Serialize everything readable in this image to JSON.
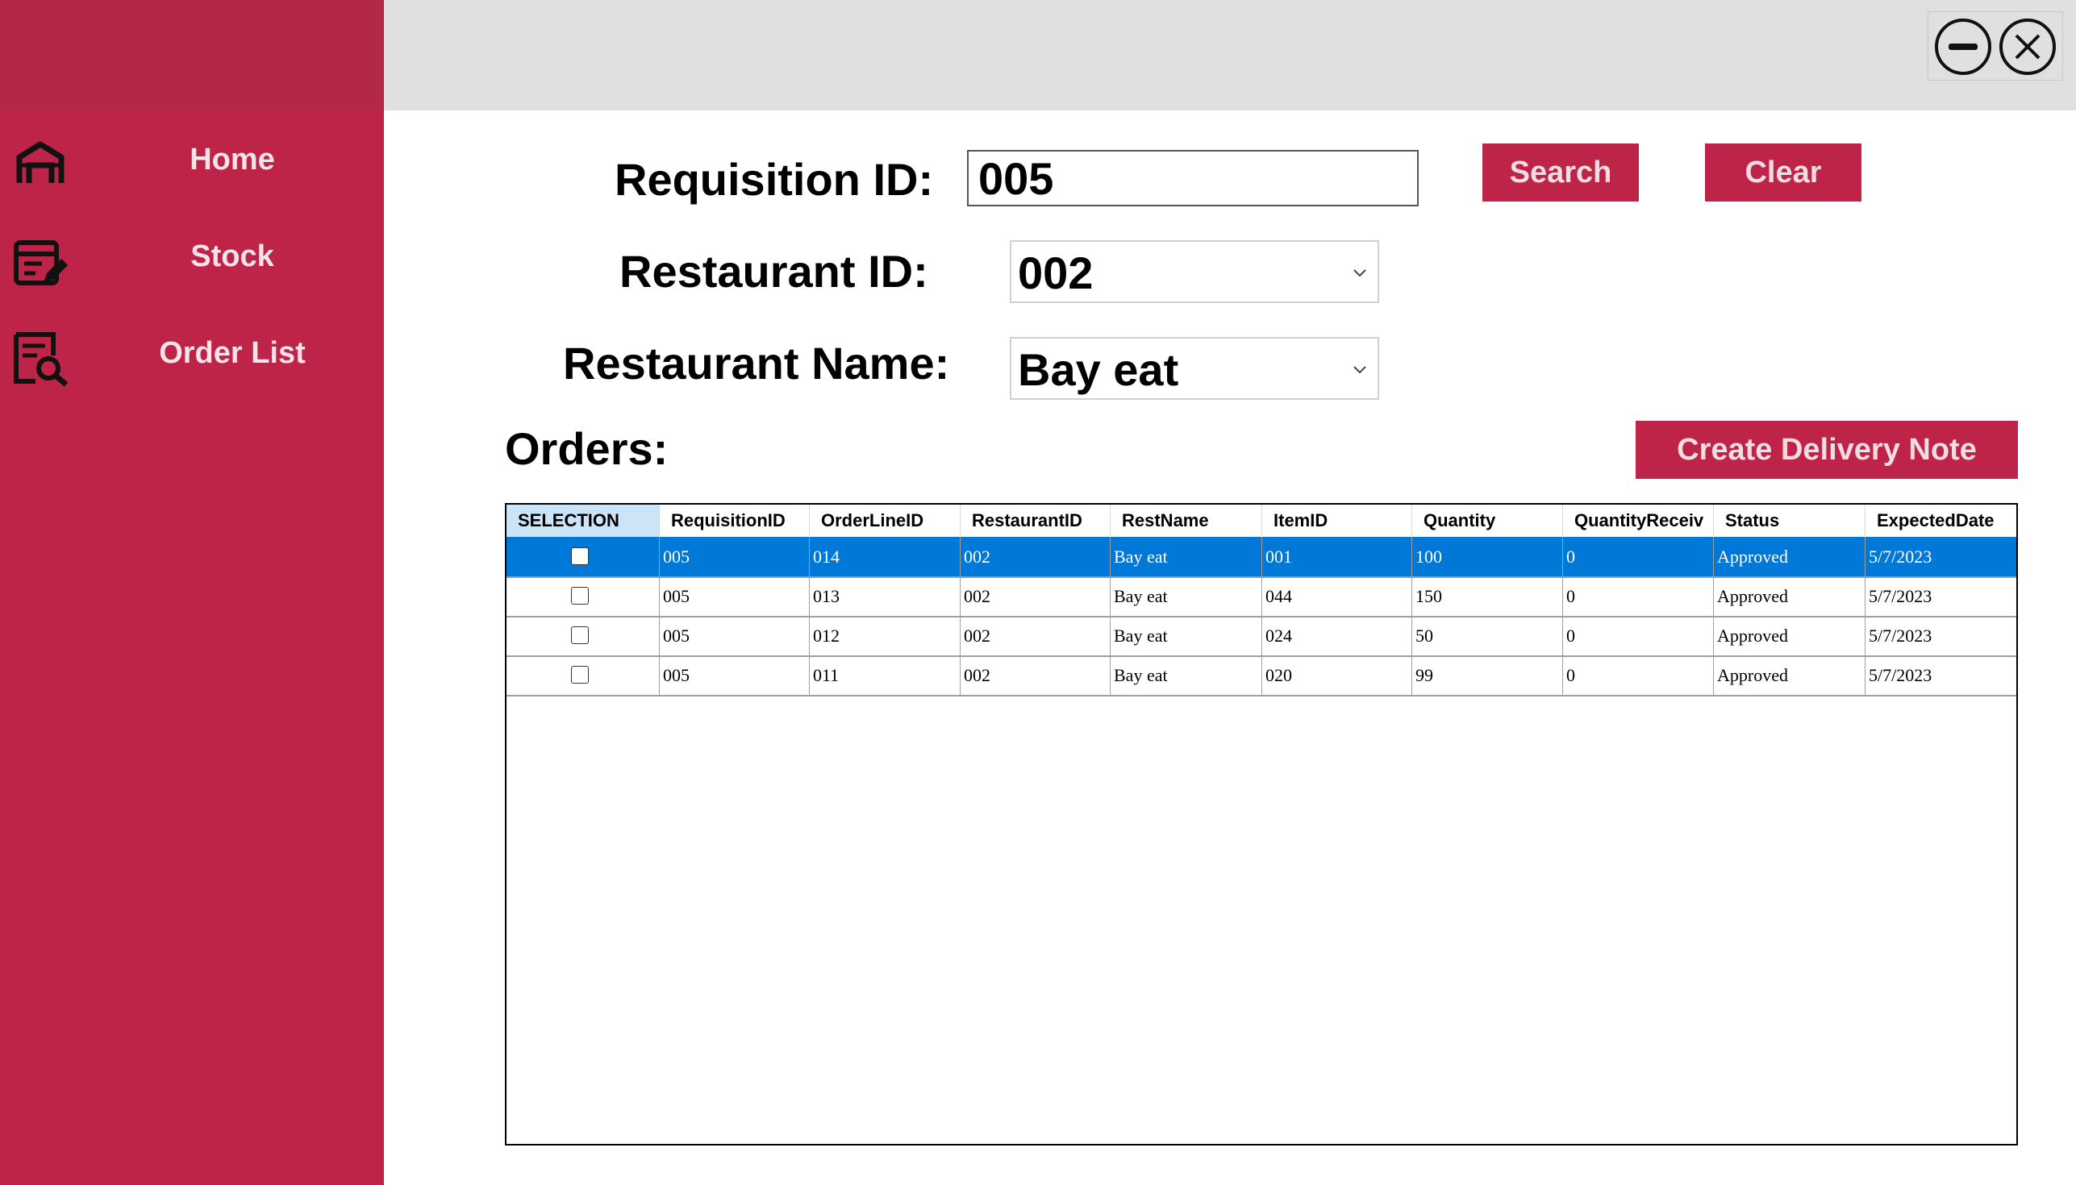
{
  "sidebar": {
    "items": [
      {
        "label": "Home",
        "icon": "home-icon"
      },
      {
        "label": "Stock",
        "icon": "stock-icon"
      },
      {
        "label": "Order List",
        "icon": "order-list-icon"
      }
    ]
  },
  "window_controls": {
    "minimize_icon": "minimize-icon",
    "close_icon": "close-icon"
  },
  "form": {
    "requisition_label": "Requisition ID:",
    "requisition_value": "005",
    "restaurant_id_label": "Restaurant ID:",
    "restaurant_id_value": "002",
    "restaurant_name_label": "Restaurant Name:",
    "restaurant_name_value": "Bay eat",
    "search_label": "Search",
    "clear_label": "Clear"
  },
  "orders": {
    "title": "Orders:",
    "create_label": "Create Delivery Note",
    "columns": [
      "SELECTION",
      "RequisitionID",
      "OrderLineID",
      "RestaurantID",
      "RestName",
      "ItemID",
      "Quantity",
      "QuantityReceiv",
      "Status",
      "ExpectedDate"
    ],
    "rows": [
      {
        "selected": true,
        "checked": false,
        "cells": [
          "005",
          "014",
          "002",
          "Bay eat",
          "001",
          "100",
          "0",
          "Approved",
          "5/7/2023"
        ]
      },
      {
        "selected": false,
        "checked": false,
        "cells": [
          "005",
          "013",
          "002",
          "Bay eat",
          "044",
          "150",
          "0",
          "Approved",
          "5/7/2023"
        ]
      },
      {
        "selected": false,
        "checked": false,
        "cells": [
          "005",
          "012",
          "002",
          "Bay eat",
          "024",
          "50",
          "0",
          "Approved",
          "5/7/2023"
        ]
      },
      {
        "selected": false,
        "checked": false,
        "cells": [
          "005",
          "011",
          "002",
          "Bay eat",
          "020",
          "99",
          "0",
          "Approved",
          "5/7/2023"
        ]
      }
    ]
  },
  "colors": {
    "accent": "#bd2447",
    "selection": "#0078d7",
    "header_highlight": "#cce4f7"
  }
}
